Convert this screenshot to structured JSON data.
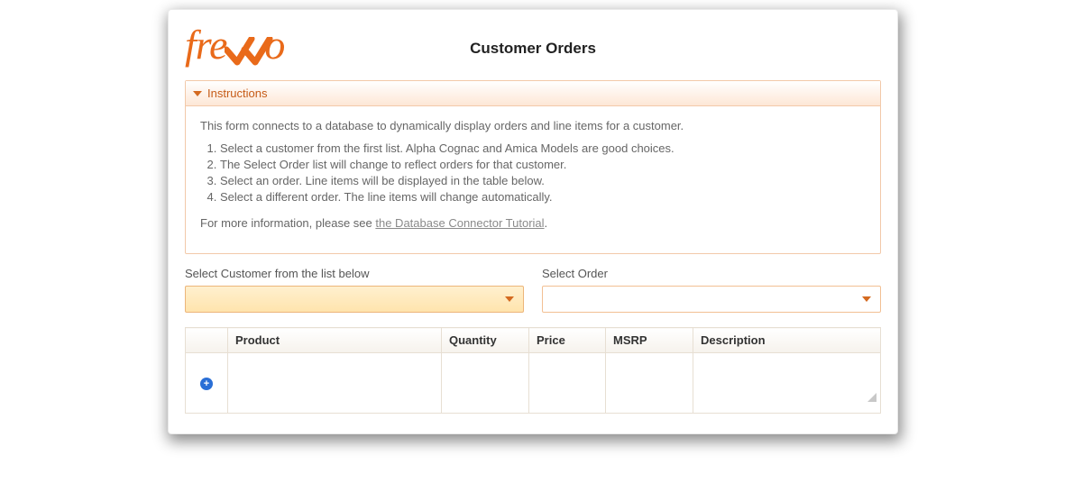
{
  "brand": {
    "name": "frevvo",
    "color": "#e96a1a"
  },
  "header": {
    "title": "Customer Orders"
  },
  "instructions": {
    "title": "Instructions",
    "intro": "This form connects to a database to dynamically display orders and line items for a customer.",
    "steps": [
      "Select a customer from the first list. Alpha Cognac and Amica Models are good choices.",
      "The Select Order list will change to reflect orders for that customer.",
      "Select an order. Line items will be displayed in the table below.",
      "Select a different order. The line items will change automatically."
    ],
    "more_prefix": "For more information, please see ",
    "more_link": "the Database Connector Tutorial"
  },
  "fields": {
    "customer": {
      "label": "Select Customer from the list below",
      "value": "",
      "required": true
    },
    "order": {
      "label": "Select Order",
      "value": "",
      "required": false
    }
  },
  "table": {
    "columns": [
      "Product",
      "Quantity",
      "Price",
      "MSRP",
      "Description"
    ],
    "rows": [
      {
        "product": "",
        "quantity": "",
        "price": "",
        "msrp": "",
        "description": ""
      }
    ]
  }
}
